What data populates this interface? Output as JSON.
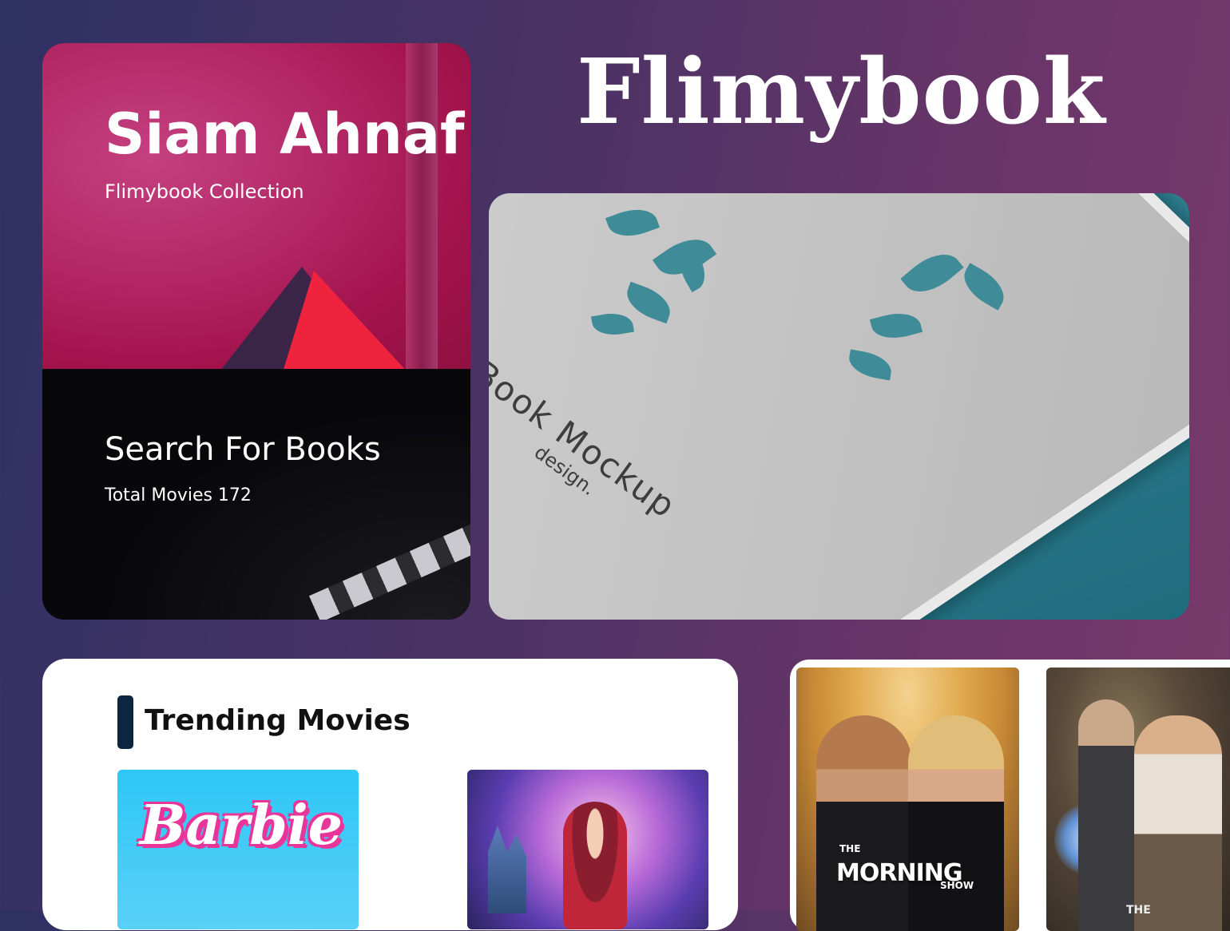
{
  "brand": {
    "title": "Flimybook"
  },
  "profile": {
    "name": "Siam Ahnaf",
    "subtitle": "Flimybook Collection",
    "search_title": "Search For Books",
    "total_line": "Total Movies 172"
  },
  "book_mockup": {
    "line1": "Book Mockup",
    "line2": "design."
  },
  "trending": {
    "title": "Trending Movies",
    "items": [
      {
        "logo_text": "Barbie"
      },
      {
        "logo_text": ""
      }
    ]
  },
  "posters": [
    {
      "the": "THE",
      "logo_text": "MORNING",
      "sub": "SHOW"
    },
    {
      "logo_text": "THE"
    }
  ],
  "colors": {
    "accent_bar": "#0d2640",
    "background_start": "#2f3163",
    "background_end": "#7a3a6b",
    "barbie_pink": "#e8359a"
  }
}
